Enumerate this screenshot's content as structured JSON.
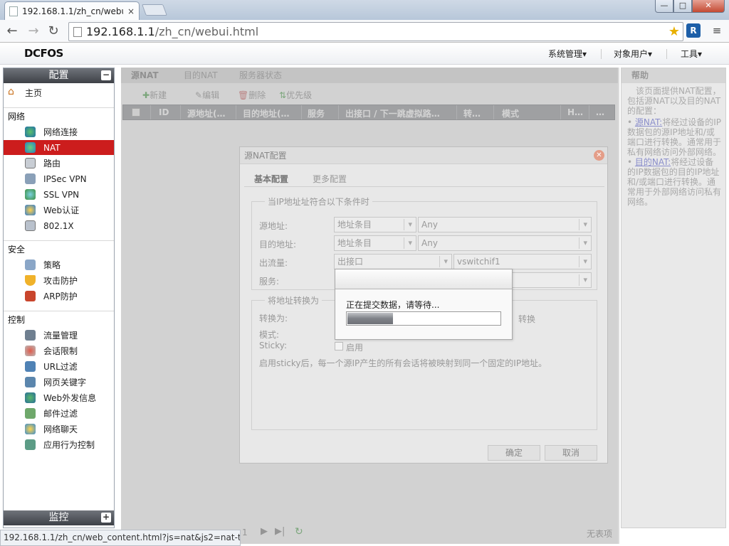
{
  "browser": {
    "tab_title": "192.168.1.1/zh_cn/webu",
    "tab_close": "×",
    "url_host": "192.168.1.1",
    "url_path": "/zh_cn/webui.html",
    "window_buttons": {
      "min": "—",
      "max": "□",
      "close": "✕"
    }
  },
  "header": {
    "logo": "DCFOS",
    "menus": [
      "系统管理▾",
      "对象用户▾",
      "工具▾"
    ]
  },
  "sidebar": {
    "config_title": "配置",
    "config_toggle": "−",
    "home": "主页",
    "sections": {
      "network": "网络",
      "security": "安全",
      "control": "控制"
    },
    "network_items": [
      "网络连接",
      "NAT",
      "路由",
      "IPSec VPN",
      "SSL VPN",
      "Web认证",
      "802.1X"
    ],
    "security_items": [
      "策略",
      "攻击防护",
      "ARP防护"
    ],
    "control_items": [
      "流量管理",
      "会话限制",
      "URL过滤",
      "网页关键字",
      "Web外发信息",
      "邮件过滤",
      "网络聊天",
      "应用行为控制"
    ],
    "monitor_title": "监控",
    "monitor_toggle": "+",
    "active_item": "NAT"
  },
  "content": {
    "tabs": [
      "源NAT",
      "目的NAT",
      "服务器状态"
    ],
    "toolbar": [
      "新建",
      "编辑",
      "删除",
      "优先级"
    ],
    "columns": [
      "ID",
      "源地址(…",
      "目的地址(…",
      "服务",
      "出接口 / 下一跳虚拟路…",
      "转…",
      "模式",
      "H…",
      "…"
    ],
    "pager_page": "1",
    "no_items": "无表项"
  },
  "help": {
    "title": "帮助",
    "intro": "该页面提供NAT配置，包括源NAT以及目的NAT的配置：",
    "items": [
      {
        "link": "源NAT:",
        "text": "将经过设备的IP数据包的源IP地址和/或端口进行转换。通常用于私有网络访问外部网络。"
      },
      {
        "link": "目的NAT:",
        "text": "将经过设备的IP数据包的目的IP地址和/或端口进行转换。通常用于外部网络访问私有网络。"
      }
    ]
  },
  "dialog": {
    "title": "源NAT配置",
    "tabs": [
      "基本配置",
      "更多配置"
    ],
    "condition_legend": "当IP地址址符合以下条件时",
    "src_label": "源地址:",
    "src_type": "地址条目",
    "src_value": "Any",
    "dst_label": "目的地址:",
    "dst_type": "地址条目",
    "dst_value": "Any",
    "egress_label": "出流量:",
    "egress_type": "出接口",
    "egress_value": "vswitchif1",
    "service_label": "服务:",
    "translate_legend": "将地址转换为",
    "translate_to_label": "转换为:",
    "translate_hidden_text": "转换",
    "mode_label": "模式:",
    "sticky_label": "Sticky:",
    "sticky_option": "启用",
    "sticky_note": "启用sticky后，每一个源IP产生的所有会话将被映射到同一个固定的IP地址。",
    "ok": "确定",
    "cancel": "取消"
  },
  "progress": {
    "message": "正在提交数据，请等待...",
    "value": 0.3
  },
  "status_bar": "192.168.1.1/zh_cn/web_content.html?js=nat&js2=nat-to..."
}
